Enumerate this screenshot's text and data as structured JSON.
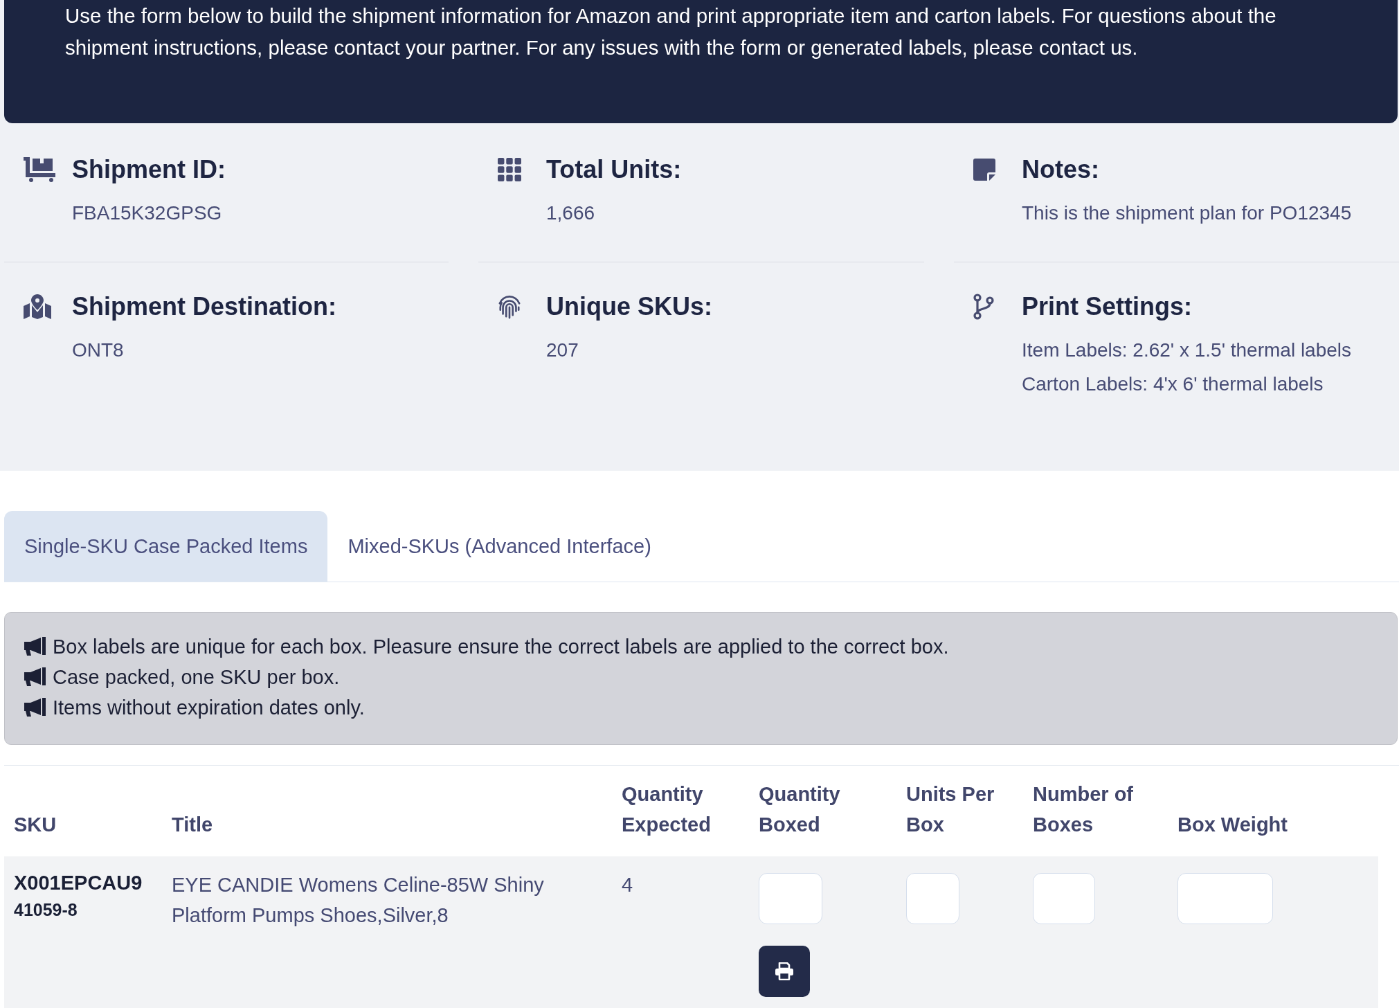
{
  "banner": {
    "text": "Use the form below to build the shipment information for Amazon and print appropriate item and carton labels. For questions about the shipment instructions, please contact your partner. For any issues with the form or generated labels, please contact us."
  },
  "summary": [
    {
      "kind": "dolly",
      "label": "Shipment ID:",
      "values": [
        "FBA15K32GPSG"
      ]
    },
    {
      "kind": "grid",
      "label": "Total Units:",
      "values": [
        "1,666"
      ]
    },
    {
      "kind": "note",
      "label": "Notes:",
      "values": [
        "This is the shipment plan for PO12345"
      ]
    },
    {
      "kind": "map",
      "label": "Shipment Destination:",
      "values": [
        "ONT8"
      ]
    },
    {
      "kind": "fingerprint",
      "label": "Unique SKUs:",
      "values": [
        "207"
      ]
    },
    {
      "kind": "branch",
      "label": "Print Settings:",
      "values": [
        "Item Labels: 2.62' x 1.5' thermal labels",
        "Carton Labels: 4'x 6' thermal labels"
      ]
    }
  ],
  "tabs": [
    {
      "label": "Single-SKU Case Packed Items",
      "selected": true
    },
    {
      "label": "Mixed-SKUs (Advanced Interface)",
      "selected": false
    }
  ],
  "notices": [
    "Box labels are unique for each box. Pleasure ensure the correct labels are applied to the correct box.",
    "Case packed, one SKU per box.",
    "Items without expiration dates only."
  ],
  "table": {
    "columns": [
      {
        "label": "SKU",
        "kind": "sku"
      },
      {
        "label": "Title",
        "kind": "title"
      },
      {
        "label": "Quantity Expected",
        "kind": "quantity"
      },
      {
        "label": "Quantity Boxed",
        "kind": "input"
      },
      {
        "label": "Units Per Box",
        "kind": "input"
      },
      {
        "label": "Number of Boxes",
        "kind": "input"
      },
      {
        "label": "Box Weight",
        "kind": "input"
      }
    ],
    "rows": [
      {
        "sku": "X001EPCAU9",
        "sku_secondary": "41059-8",
        "title": "EYE CANDIE Womens Celine-85W Shiny Platform Pumps Shoes,Silver,8",
        "quantity_expected": "4",
        "print_button": true
      }
    ]
  }
}
